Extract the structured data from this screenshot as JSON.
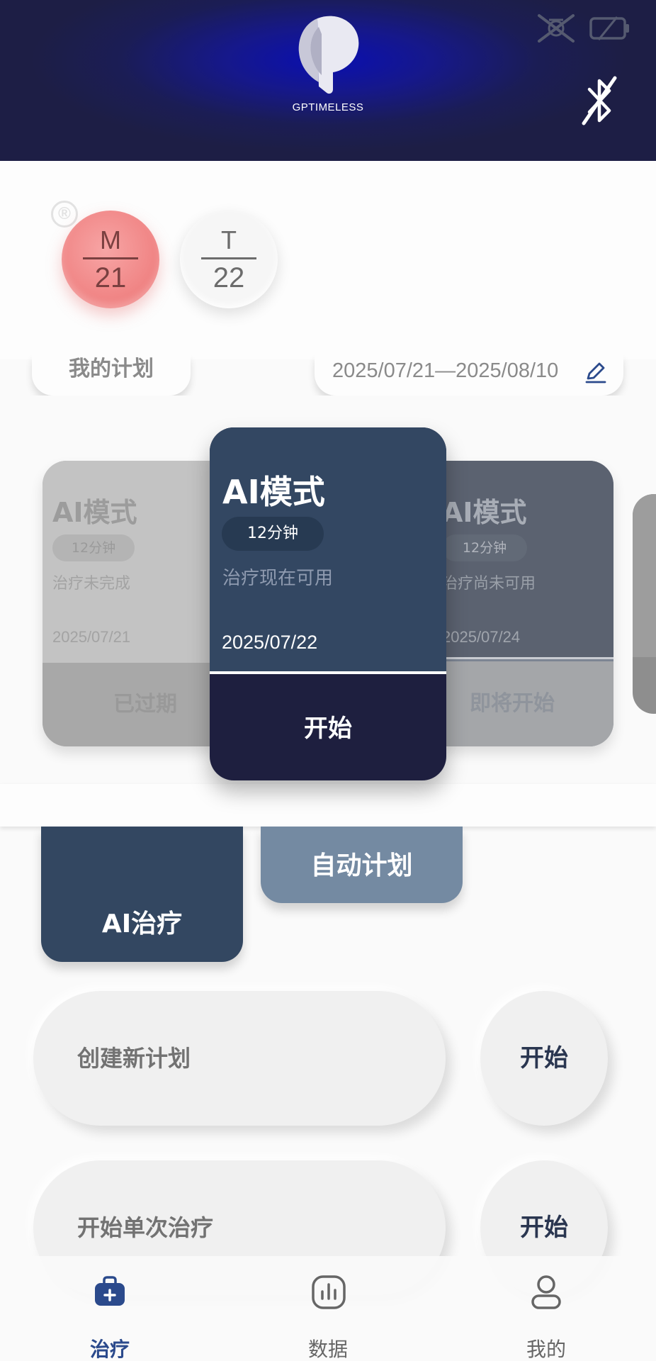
{
  "header": {
    "brand": "GPTIMELESS",
    "status_icons": [
      "stylus-off-icon",
      "battery-empty-icon"
    ],
    "bluetooth_icon": "bluetooth-off-icon"
  },
  "week": {
    "registered_mark": "®",
    "days": [
      {
        "weekday": "M",
        "date": "21",
        "selected": true
      },
      {
        "weekday": "T",
        "date": "22",
        "selected": false
      }
    ]
  },
  "plan": {
    "tab_label": "我的计划",
    "date_range": "2025/07/21—2025/08/10"
  },
  "cards": {
    "left": {
      "title": "AI模式",
      "duration": "12分钟",
      "status": "治疗未完成",
      "date": "2025/07/21",
      "action": "已过期"
    },
    "center": {
      "title": "AI模式",
      "duration": "12分钟",
      "status": "治疗现在可用",
      "date": "2025/07/22",
      "action": "开始"
    },
    "right": {
      "title": "AI模式",
      "duration": "12分钟",
      "status": "治疗尚未可用",
      "date": "2025/07/24",
      "action": "即将开始"
    }
  },
  "modes": {
    "ai_therapy": "AI治疗",
    "auto_plan": "自动计划"
  },
  "actions": [
    {
      "label": "创建新计划",
      "button": "开始"
    },
    {
      "label": "开始单次治疗",
      "button": "开始"
    }
  ],
  "nav": {
    "treatment": "治疗",
    "data": "数据",
    "mine": "我的",
    "active": "治疗"
  },
  "colors": {
    "header": "#1b1d55",
    "accent_card": "#334762",
    "selected_day": "#ef7e7e",
    "nav_active": "#2b4a8c"
  }
}
